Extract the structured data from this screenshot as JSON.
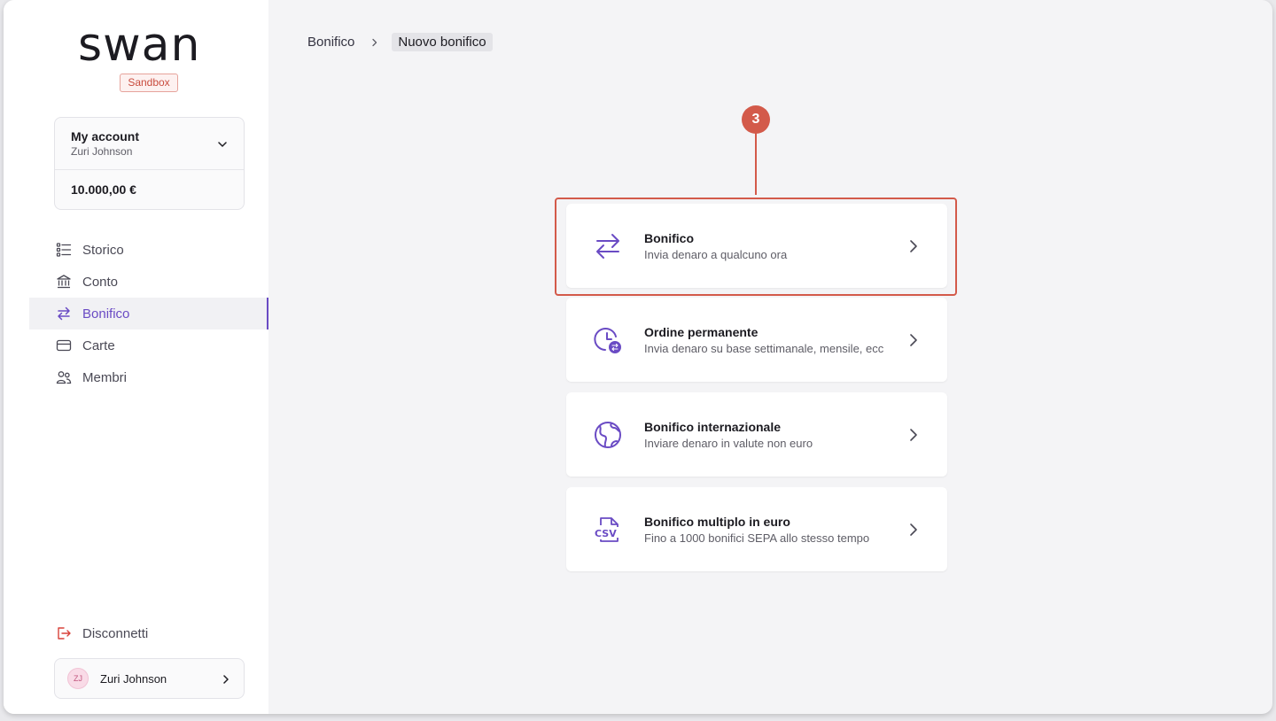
{
  "app": {
    "logo_text": "swan",
    "environment_badge": "Sandbox",
    "accent_color": "#6a4bc4",
    "highlight_color": "#d35a4a"
  },
  "account": {
    "name": "My account",
    "holder": "Zuri Johnson",
    "balance": "10.000,00 €"
  },
  "nav": {
    "items": [
      {
        "label": "Storico",
        "icon": "list-icon",
        "active": false
      },
      {
        "label": "Conto",
        "icon": "bank-icon",
        "active": false
      },
      {
        "label": "Bonifico",
        "icon": "transfer-arrows-icon",
        "active": true
      },
      {
        "label": "Carte",
        "icon": "card-icon",
        "active": false
      },
      {
        "label": "Membri",
        "icon": "members-icon",
        "active": false
      }
    ],
    "logout_label": "Disconnetti"
  },
  "user": {
    "initials": "ZJ",
    "name": "Zuri Johnson"
  },
  "breadcrumb": {
    "parent": "Bonifico",
    "current": "Nuovo bonifico"
  },
  "step": {
    "number": "3"
  },
  "transfer_options": [
    {
      "title": "Bonifico",
      "subtitle": "Invia denaro a qualcuno ora",
      "icon": "transfer-arrows-icon"
    },
    {
      "title": "Ordine permanente",
      "subtitle": "Invia denaro su base settimanale, mensile, ecc",
      "icon": "recurring-clock-icon"
    },
    {
      "title": "Bonifico internazionale",
      "subtitle": "Inviare denaro in valute non euro",
      "icon": "globe-icon"
    },
    {
      "title": "Bonifico multiplo in euro",
      "subtitle": "Fino a 1000 bonifici SEPA allo stesso tempo",
      "icon": "csv-file-icon"
    }
  ]
}
